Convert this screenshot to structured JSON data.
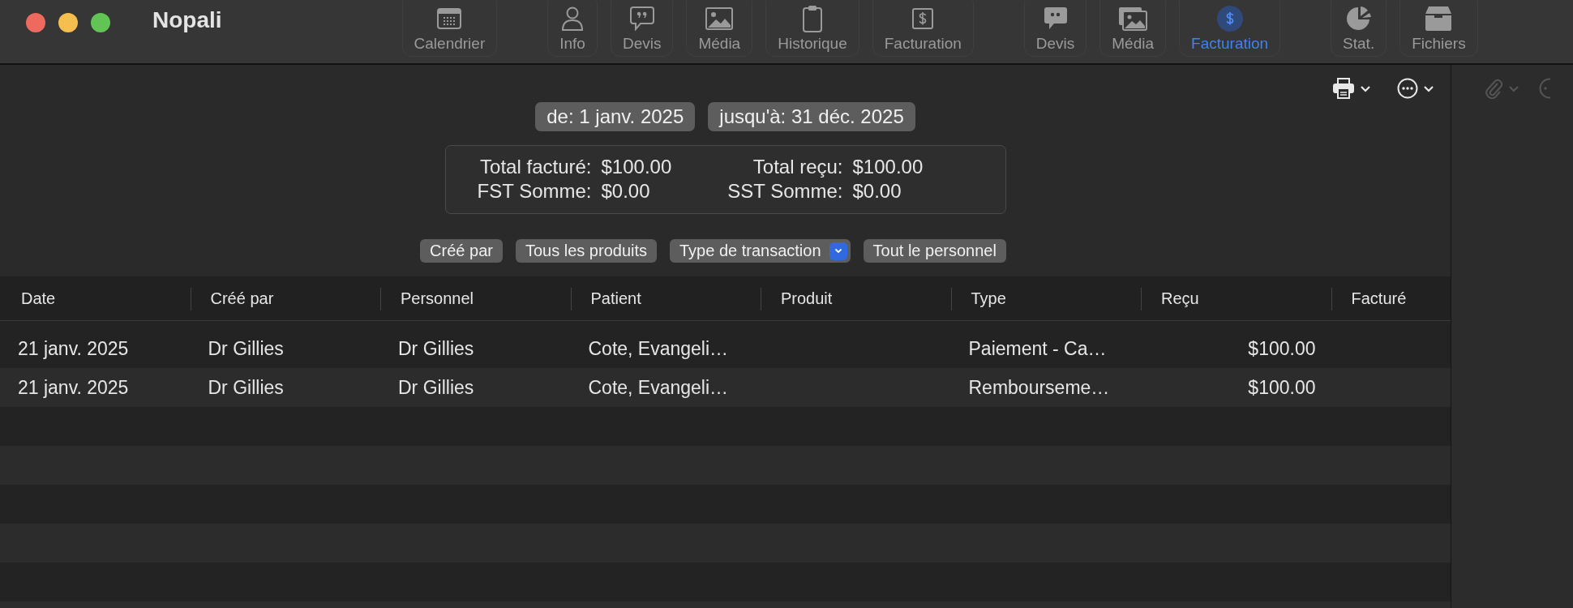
{
  "window": {
    "title": "Nopali"
  },
  "toolbar": [
    {
      "label": "Calendrier",
      "selected": false
    },
    {
      "label": "Info",
      "selected": false
    },
    {
      "label": "Devis",
      "selected": false
    },
    {
      "label": "Média",
      "selected": false
    },
    {
      "label": "Historique",
      "selected": false
    },
    {
      "label": "Facturation",
      "selected": false
    },
    {
      "label": "Devis",
      "selected": false
    },
    {
      "label": "Média",
      "selected": false
    },
    {
      "label": "Facturation",
      "selected": true
    },
    {
      "label": "Stat.",
      "selected": false
    },
    {
      "label": "Fichiers",
      "selected": false
    }
  ],
  "date_range": [
    "de: 1 janv. 2025",
    "jusqu'à: 31 déc. 2025"
  ],
  "summary": [
    {
      "label": "Total facturé:",
      "value": "$100.00"
    },
    {
      "label": "Total reçu:",
      "value": "$100.00"
    },
    {
      "label": "FST Somme:",
      "value": "$0.00"
    },
    {
      "label": "SST Somme:",
      "value": "$0.00"
    }
  ],
  "filters": [
    {
      "label": "Créé par",
      "kind": "button"
    },
    {
      "label": "Tous les produits",
      "kind": "button"
    },
    {
      "label": "Type de transaction",
      "kind": "popup"
    },
    {
      "label": "Tout le personnel",
      "kind": "button"
    }
  ],
  "table": {
    "columns": [
      "Date",
      "Créé par",
      "Personnel",
      "Patient",
      "Produit",
      "Type",
      "Reçu",
      "Facturé"
    ],
    "rows": [
      [
        "21 janv. 2025",
        "Dr Gillies",
        "Dr Gillies",
        "Cote, Evangeli…",
        "",
        "Paiement - Ca…",
        "$100.00",
        ""
      ],
      [
        "21 janv. 2025",
        "Dr Gillies",
        "Dr Gillies",
        "Cote, Evangeli…",
        "",
        "Rembourseme…",
        "$100.00",
        ""
      ]
    ]
  }
}
